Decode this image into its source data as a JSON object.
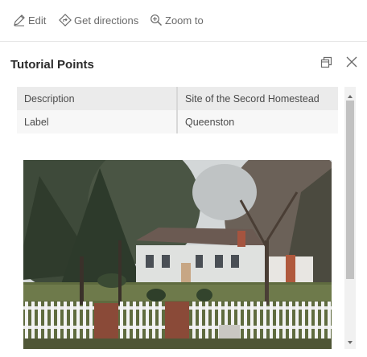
{
  "toolbar": {
    "edit_label": "Edit",
    "directions_label": "Get directions",
    "zoom_label": "Zoom to"
  },
  "popup": {
    "title": "Tutorial Points"
  },
  "attributes": [
    {
      "field": "Description",
      "value": "Site of the Secord Homestead"
    },
    {
      "field": "Label",
      "value": "Queenston"
    }
  ],
  "icons": {
    "edit": "edit-icon",
    "directions": "directions-icon",
    "zoom": "zoom-in-icon",
    "dock": "dock-icon",
    "close": "close-icon"
  },
  "colors": {
    "toolbar_text": "#6a6a6a",
    "title_text": "#2b2b2b",
    "row_header_bg": "#ebebeb",
    "row_alt_bg": "#f7f7f7"
  }
}
